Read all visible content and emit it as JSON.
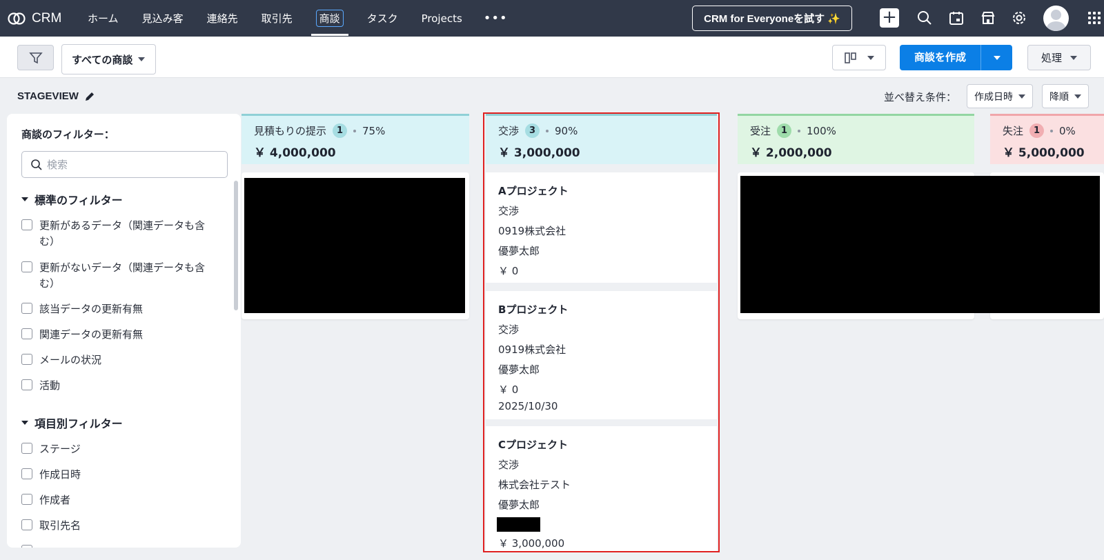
{
  "app": {
    "name": "CRM"
  },
  "nav": {
    "items": [
      "ホーム",
      "見込み客",
      "連絡先",
      "取引先",
      "商談",
      "タスク",
      "Projects"
    ],
    "active_index": 4,
    "more": "•••",
    "try_button": "CRM for Everyoneを試す",
    "try_spark": "✨"
  },
  "toolbar": {
    "view_select": "すべての商談",
    "create_button": "商談を作成",
    "action_button": "処理"
  },
  "stageview": {
    "title": "STAGEVIEW",
    "sort_label": "並べ替え条件：",
    "sort_field": "作成日時",
    "sort_order": "降順"
  },
  "filters": {
    "title": "商談のフィルター：",
    "search_placeholder": "検索",
    "section_standard": "標準のフィルター",
    "standard_items": [
      "更新があるデータ（関連データも含む）",
      "更新がないデータ（関連データも含む）",
      "該当データの更新有無",
      "関連データの更新有無",
      "メールの状況",
      "活動"
    ],
    "section_field": "項目別フィルター",
    "field_items": [
      "ステージ",
      "作成日時",
      "作成者",
      "取引先名"
    ]
  },
  "columns": [
    {
      "stage": "見積もりの提示",
      "count": "1",
      "probability": "75%",
      "amount": "￥ 4,000,000",
      "color": "#d9f3f7",
      "accent": "#8fd0d6",
      "badge": "#a6dde2"
    },
    {
      "stage": "交渉",
      "count": "3",
      "probability": "90%",
      "amount": "￥ 3,000,000",
      "color": "#d9f3f7",
      "accent": "#8fd0d6",
      "badge": "#a6dde2"
    },
    {
      "stage": "受注",
      "count": "1",
      "probability": "100%",
      "amount": "￥ 2,000,000",
      "color": "#dff5e3",
      "accent": "#93d6a2",
      "badge": "#9fdcab"
    },
    {
      "stage": "失注",
      "count": "1",
      "probability": "0%",
      "amount": "￥ 5,000,000",
      "color": "#fbe0e1",
      "accent": "#f0a6aa",
      "badge": "#f1aeb2"
    }
  ],
  "deals": [
    {
      "name": "Aプロジェクト",
      "stage": "交渉",
      "account": "0919株式会社",
      "owner": "優夢太郎",
      "amount": "￥ 0",
      "date": ""
    },
    {
      "name": "Bプロジェクト",
      "stage": "交渉",
      "account": "0919株式会社",
      "owner": "優夢太郎",
      "amount": "￥ 0",
      "date": "2025/10/30"
    },
    {
      "name": "Cプロジェクト",
      "stage": "交渉",
      "account": "株式会社テスト",
      "owner": "優夢太郎",
      "amount": "￥ 3,000,000",
      "date": ""
    }
  ]
}
